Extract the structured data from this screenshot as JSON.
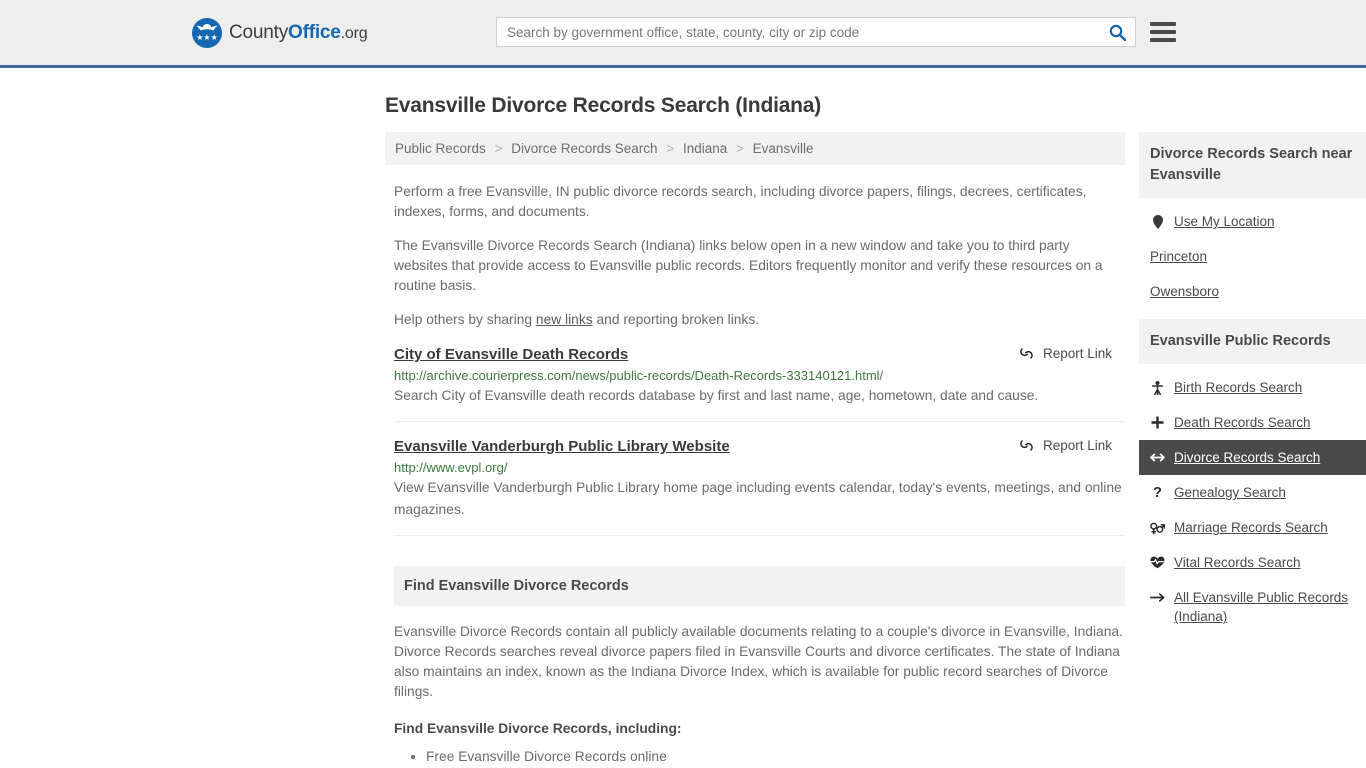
{
  "header": {
    "logo": {
      "icon": "eagle-shield-logo",
      "part1": "County",
      "part2": "Office",
      "part3": ".org"
    },
    "search": {
      "placeholder": "Search by government office, state, county, city or zip code",
      "value": "",
      "icon": "search-icon"
    },
    "menu_icon": "hamburger-menu-icon",
    "accent_color": "#3b6e9e",
    "background_color": "#eeeeec"
  },
  "page_title": "Evansville Divorce Records Search (Indiana)",
  "breadcrumb": {
    "separator": ">",
    "items": [
      {
        "label": "Public Records"
      },
      {
        "label": "Divorce Records Search"
      },
      {
        "label": "Indiana"
      },
      {
        "label": "Evansville"
      }
    ]
  },
  "intro": {
    "p1": "Perform a free Evansville, IN public divorce records search, including divorce papers, filings, decrees, certificates, indexes, forms, and documents.",
    "p2": "The Evansville Divorce Records Search (Indiana) links below open in a new window and take you to third party websites that provide access to Evansville public records. Editors frequently monitor and verify these resources on a routine basis.",
    "p3_before": "Help others by sharing ",
    "p3_link": "new links",
    "p3_after": " and reporting broken links."
  },
  "results": {
    "report_label": "Report Link",
    "report_icon": "broken-link-icon",
    "items": [
      {
        "title": "City of Evansville Death Records",
        "url": "http://archive.courierpress.com/news/public-records/Death-Records-333140121.html/",
        "description": "Search City of Evansville death records database by first and last name, age, hometown, date and cause."
      },
      {
        "title": "Evansville Vanderburgh Public Library Website",
        "url": "http://www.evpl.org/",
        "description": "View Evansville Vanderburgh Public Library home page including events calendar, today's events, meetings, and online magazines."
      }
    ]
  },
  "section": {
    "heading": "Find Evansville Divorce Records",
    "paragraph": "Evansville Divorce Records contain all publicly available documents relating to a couple's divorce in Evansville, Indiana. Divorce Records searches reveal divorce papers filed in Evansville Courts and divorce certificates. The state of Indiana also maintains an index, known as the Indiana Divorce Index, which is available for public record searches of Divorce filings.",
    "list_heading": "Find Evansville Divorce Records, including:",
    "list_items": [
      "Free Evansville Divorce Records online"
    ]
  },
  "sidebar": {
    "nearby": {
      "heading": "Divorce Records Search near Evansville",
      "items": [
        {
          "label": "Use My Location",
          "icon": "map-pin-icon",
          "glyph": "⮟"
        },
        {
          "label": "Princeton",
          "icon": "",
          "glyph": ""
        },
        {
          "label": "Owensboro",
          "icon": "",
          "glyph": ""
        }
      ]
    },
    "public_records": {
      "heading": "Evansville Public Records",
      "items": [
        {
          "label": "Birth Records Search",
          "icon": "child-icon",
          "glyph": "Ɣ",
          "active": false
        },
        {
          "label": "Death Records Search",
          "icon": "cross-icon",
          "glyph": "✚",
          "active": false
        },
        {
          "label": "Divorce Records Search",
          "icon": "left-right-arrow-icon",
          "glyph": "↔",
          "active": true
        },
        {
          "label": "Genealogy Search",
          "icon": "question-mark-icon",
          "glyph": "?",
          "active": false
        },
        {
          "label": "Marriage Records Search",
          "icon": "male-female-icon",
          "glyph": "⚥",
          "active": false
        },
        {
          "label": "Vital Records Search",
          "icon": "heartbeat-icon",
          "glyph": "♥",
          "active": false
        },
        {
          "label": "All Evansville Public Records (Indiana)",
          "icon": "arrow-right-icon",
          "glyph": "→",
          "active": false
        }
      ]
    }
  }
}
